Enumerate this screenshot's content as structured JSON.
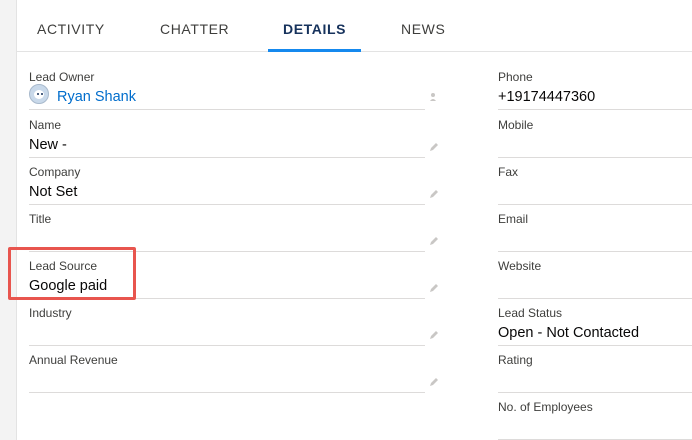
{
  "tabs": [
    {
      "label": "ACTIVITY"
    },
    {
      "label": "CHATTER"
    },
    {
      "label": "DETAILS"
    },
    {
      "label": "NEWS"
    }
  ],
  "left_fields": {
    "lead_owner": {
      "label": "Lead Owner",
      "value": "Ryan Shank"
    },
    "name": {
      "label": "Name",
      "value": "New -"
    },
    "company": {
      "label": "Company",
      "value": "Not Set"
    },
    "title": {
      "label": "Title",
      "value": ""
    },
    "lead_source": {
      "label": "Lead Source",
      "value": "Google paid"
    },
    "industry": {
      "label": "Industry",
      "value": ""
    },
    "annual_revenue": {
      "label": "Annual Revenue",
      "value": ""
    }
  },
  "right_fields": {
    "phone": {
      "label": "Phone",
      "value": "+19174447360"
    },
    "mobile": {
      "label": "Mobile",
      "value": ""
    },
    "fax": {
      "label": "Fax",
      "value": ""
    },
    "email": {
      "label": "Email",
      "value": ""
    },
    "website": {
      "label": "Website",
      "value": ""
    },
    "lead_status": {
      "label": "Lead Status",
      "value": "Open - Not Contacted"
    },
    "rating": {
      "label": "Rating",
      "value": ""
    },
    "employees": {
      "label": "No. of Employees",
      "value": ""
    }
  },
  "icons": {
    "edit": "pencil-icon",
    "change_owner": "change-owner-icon",
    "avatar": "user-avatar-icon"
  },
  "colors": {
    "link": "#006dcc",
    "active_tab_underline": "#1589ee",
    "highlight_box": "#e8554e"
  }
}
